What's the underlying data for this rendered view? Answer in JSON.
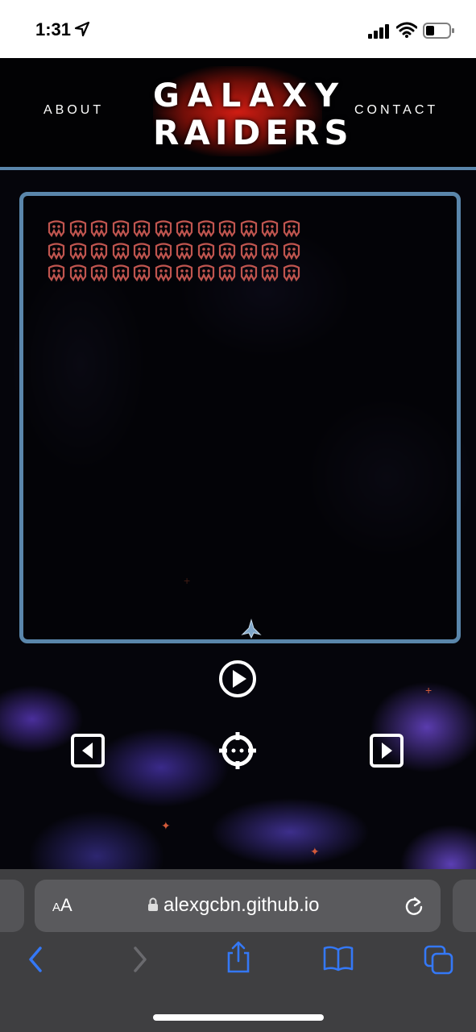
{
  "status_bar": {
    "time": "1:31"
  },
  "header": {
    "nav_left": "ABOUT",
    "nav_right": "CONTACT",
    "logo_line1": "GALAXY",
    "logo_line2": "RAIDERS"
  },
  "game": {
    "enemy_rows": 3,
    "enemy_cols": 12,
    "enemy_color": "#c0554f",
    "frame_color": "#5a86ab"
  },
  "controls": {
    "play_icon": "play-circle-icon",
    "left_icon": "arrow-left-square-icon",
    "fire_icon": "crosshair-icon",
    "right_icon": "arrow-right-square-icon"
  },
  "browser": {
    "text_size_label": "AA",
    "url": "alexgcbn.github.io",
    "accent": "#3478f6"
  }
}
